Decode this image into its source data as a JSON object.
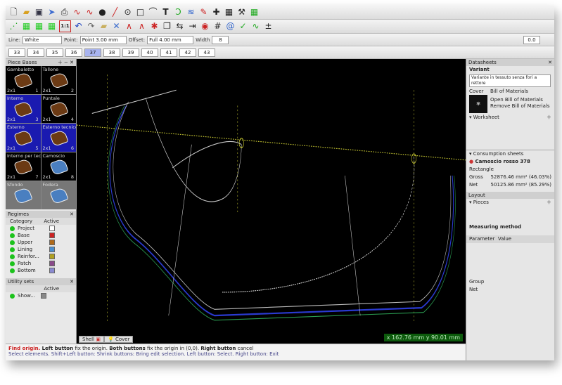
{
  "toolbar": {
    "line_label": "Line:",
    "line_color": "White",
    "point_label": "Point:",
    "point_value": "Point 3.00 mm",
    "offset_label": "Offset:",
    "offset_value": "Full 4.00 mm",
    "width_label": "Width",
    "width_value": "8",
    "scale_label": "1:1",
    "zoom_value": "0.0",
    "fields_row1": [
      "33",
      "34",
      "35",
      "36",
      "37",
      "38",
      "39",
      "40",
      "41",
      "42",
      "43"
    ]
  },
  "left": {
    "pieces_title": "Piece Bases",
    "pieces": [
      {
        "name": "Gambaletto",
        "qty": "2x1",
        "index": "1",
        "style": "black"
      },
      {
        "name": "Tallone",
        "qty": "2x1",
        "index": "2",
        "style": "black"
      },
      {
        "name": "Interno",
        "qty": "2x1",
        "index": "3",
        "style": "blue"
      },
      {
        "name": "Puntale",
        "qty": "2x1",
        "index": "4",
        "style": "black"
      },
      {
        "name": "Esterno",
        "qty": "2x1",
        "index": "5",
        "style": "blue"
      },
      {
        "name": "Esterno tecnico",
        "qty": "2x1",
        "index": "6",
        "style": "blue"
      },
      {
        "name": "Interno per tecnico",
        "qty": "2x1",
        "index": "7",
        "style": "black"
      },
      {
        "name": "Camoscio",
        "qty": "2x1",
        "index": "8",
        "style": "black-blue"
      },
      {
        "name": "Sfondo",
        "qty": "",
        "index": "",
        "style": "grey"
      },
      {
        "name": "Fodera",
        "qty": "",
        "index": "",
        "style": "grey"
      }
    ],
    "regimes_title": "Regimes",
    "regimes_cols": [
      "Category",
      "Active"
    ],
    "regimes": [
      {
        "name": "Project",
        "color": "#ffffff"
      },
      {
        "name": "Base",
        "color": "#cc2222"
      },
      {
        "name": "Upper",
        "color": "#b06a1a"
      },
      {
        "name": "Lining",
        "color": "#4a8fd0"
      },
      {
        "name": "Reinfor...",
        "color": "#b0a020"
      },
      {
        "name": "Patch",
        "color": "#8a4a8a"
      },
      {
        "name": "Bottom",
        "color": "#8a8ad0"
      }
    ],
    "utility_title": "Utility sets",
    "utility_cols": [
      "",
      "Active"
    ],
    "utility": [
      {
        "name": "Show..."
      }
    ]
  },
  "right": {
    "datasheets_title": "Datasheets",
    "variant_label": "Variant",
    "variant_value": "Variante in tessuto senza fori a rettore",
    "cover_label": "Cover",
    "bom_title": "Bill of Materials",
    "open_bom": "Open Bill of Materials",
    "remove_bom": "Remove Bill of Materials",
    "worksheet_label": "Worksheet",
    "consumption_label": "Consumption sheets",
    "material": "Camoscio rosso 378",
    "rectangle_label": "Rectangle",
    "gross_label": "Gross",
    "net_label": "Net",
    "gross_value": "52876.46 mm² (46.03%)",
    "net_value": "50125.86 mm² (85.29%)",
    "layout_label": "Layout",
    "pieces_label": "Pieces",
    "measuring_label": "Measuring method",
    "param_col": "Parameter",
    "value_col": "Value",
    "group_label": "Group",
    "net_bottom": "Net"
  },
  "status": {
    "line1_a": "Find origin.",
    "line1_b": "Left button",
    "line1_c": "fix the origin.",
    "line1_d": "Both buttons",
    "line1_e": "fix the origin in (0,0).",
    "line1_f": "Right button",
    "line1_g": "cancel",
    "line2": "Select elements. Shift+Left button: Shrink buttons: Bring edit selection. Left button: Select. Right button: Exit",
    "tab_shell": "Shell",
    "tab_cover": "Cover",
    "coords": "x 162.76 mm  y 90.01 mm"
  }
}
